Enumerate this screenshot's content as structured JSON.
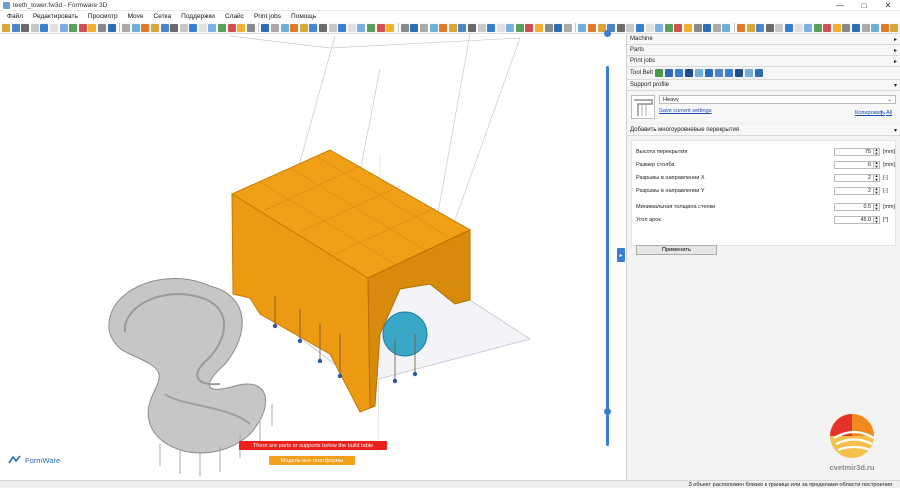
{
  "window": {
    "title": "teeth_tower.fw3d - Formware 3D"
  },
  "menu": [
    "Файл",
    "Редактировать",
    "Просмотр",
    "Move",
    "Сетка",
    "Поддержки",
    "Слайс",
    "Print jobs",
    "Помощь"
  ],
  "viewport": {
    "warning_primary": "There are parts or supports below the build table",
    "warning_secondary": "Модель вне платформы",
    "brand": "FormWare"
  },
  "panel": {
    "sections": {
      "machine": "Machine",
      "parts": "Parts",
      "print_jobs": "Print jobs"
    },
    "tool_belt": "Tool Belt",
    "support_profile": {
      "header": "Support profile",
      "selected": "Heavy",
      "save_link": "Save current settings",
      "copy_link": "Копировать",
      "all_link": "All",
      "separator": "|"
    },
    "multilevel": {
      "header": "Добавить многоуровневые перекрытия",
      "params": [
        {
          "label": "Высота перекрытия",
          "value": "75",
          "unit": "[mm]"
        },
        {
          "label": "Размер столба",
          "value": "6",
          "unit": "[mm]"
        },
        {
          "label": "Разрывы в направлении X",
          "value": "2",
          "unit": "[-]"
        },
        {
          "label": "Разрывы в направлении Y",
          "value": "2",
          "unit": "[-]"
        },
        {
          "label": "Минимальная толщина стенки",
          "value": "0.5",
          "unit": "[mm]"
        },
        {
          "label": "Угол арок",
          "value": "45.0",
          "unit": "[°]"
        }
      ],
      "apply": "Применить"
    }
  },
  "status": {
    "text": "3 объект расположен близко к границе или за пределами области построения"
  },
  "watermark": "cvetmir3d.ru",
  "colors": {
    "support": "#f0a016",
    "model": "#3aa7c9",
    "teeth": "#b8b8b8",
    "accent": "#3a7fcf",
    "warning": "#e8221c"
  }
}
